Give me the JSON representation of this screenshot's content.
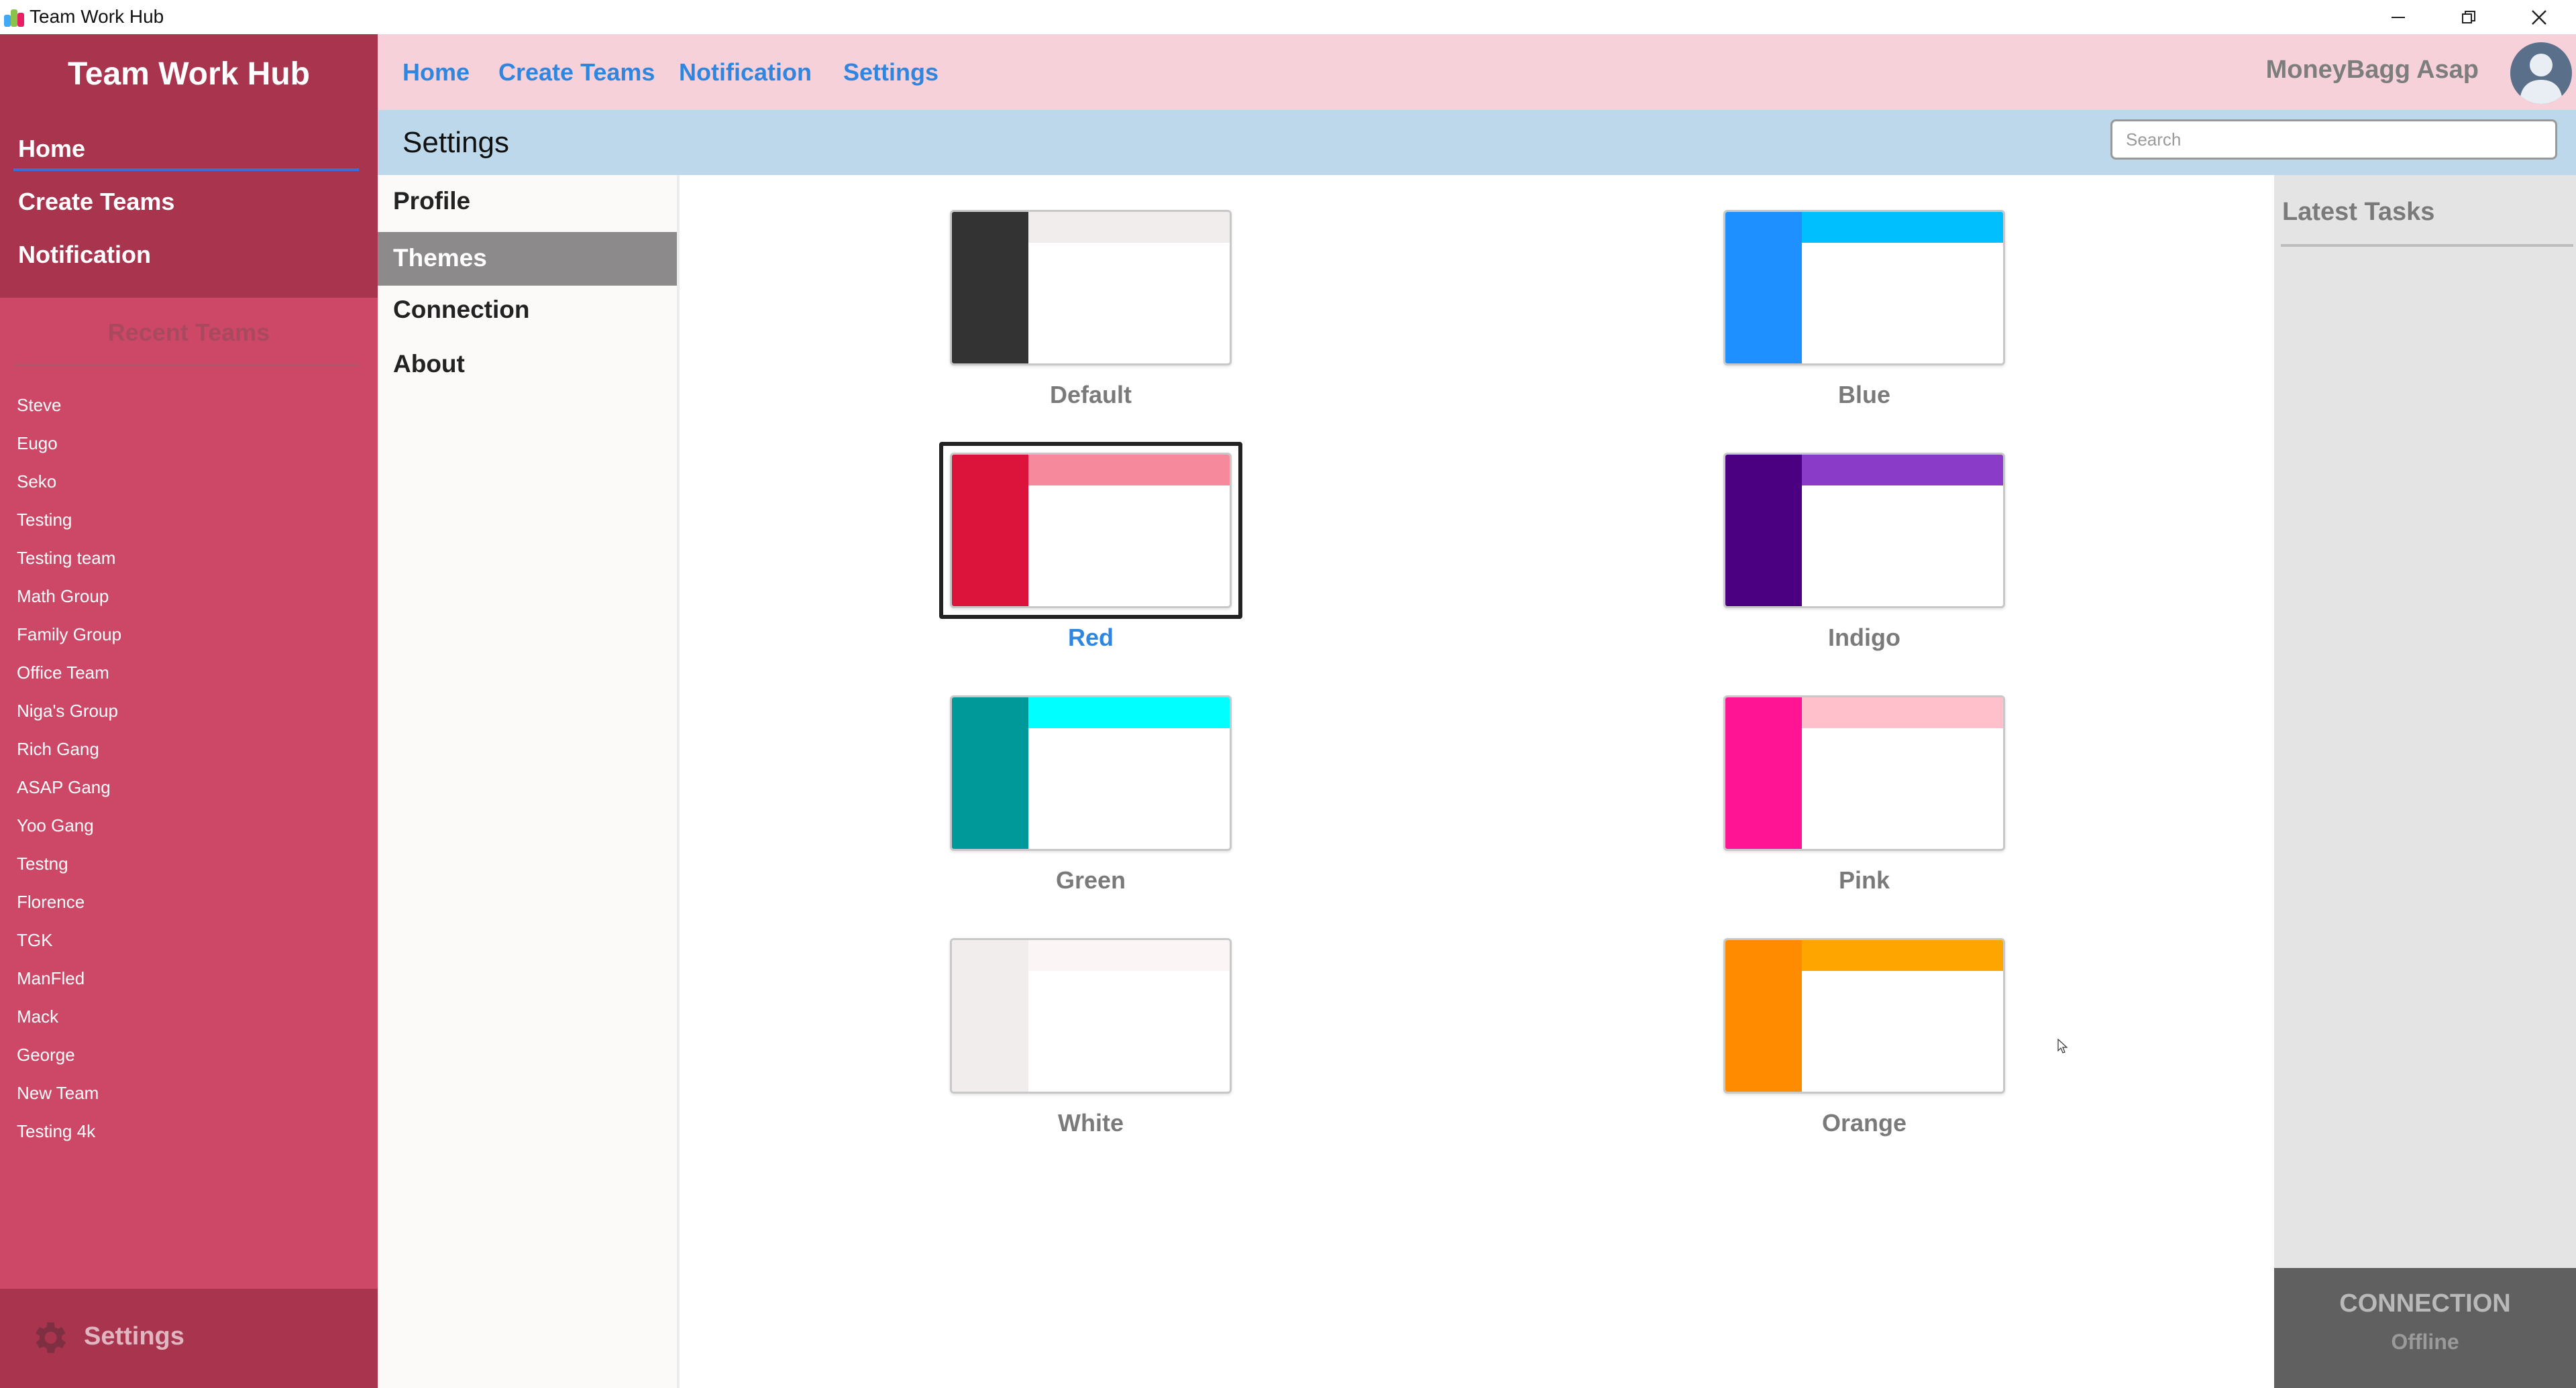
{
  "window": {
    "title": "Team Work Hub",
    "controls": [
      "minimize-icon",
      "restore-icon",
      "close-icon"
    ]
  },
  "sidebar": {
    "brand": "Team Work Hub",
    "nav": [
      {
        "label": "Home",
        "active": true
      },
      {
        "label": "Create Teams"
      },
      {
        "label": "Notification"
      }
    ],
    "recent_title": "Recent Teams",
    "recent_teams": [
      "Steve",
      "Eugo",
      "Seko",
      "Testing",
      "Testing team",
      "Math Group",
      "Family Group",
      "Office Team",
      "Niga's Group",
      "Rich Gang",
      "ASAP Gang",
      "Yoo Gang",
      "Testng",
      "Florence",
      "TGK",
      "ManFled",
      "Mack",
      "George",
      "New Team",
      "Testing 4k"
    ],
    "settings_label": "Settings",
    "settings_icon": "gear-icon"
  },
  "header": {
    "nav": [
      "Home",
      "Create Teams",
      "Notification",
      "Settings"
    ],
    "username": "MoneyBagg Asap",
    "avatar_icon": "user-avatar-icon"
  },
  "subheader": {
    "title": "Settings",
    "search_placeholder": "Search"
  },
  "settings_menu": {
    "items": [
      {
        "label": "Profile"
      },
      {
        "label": "Themes",
        "active": true
      },
      {
        "label": "Connection"
      },
      {
        "label": "About"
      }
    ]
  },
  "themes": {
    "selected": "Red",
    "items": [
      {
        "name": "Default",
        "side": "#333333",
        "head": "#f1edec"
      },
      {
        "name": "Blue",
        "side": "#1e90ff",
        "head": "#00bfff"
      },
      {
        "name": "Red",
        "side": "#dc143c",
        "head": "#f7899d"
      },
      {
        "name": "Indigo",
        "side": "#4b0082",
        "head": "#8a3cc8"
      },
      {
        "name": "Green",
        "side": "#009999",
        "head": "#00ffff"
      },
      {
        "name": "Pink",
        "side": "#ff1493",
        "head": "#ffc0cb"
      },
      {
        "name": "White",
        "side": "#f1edec",
        "head": "#fbf6f5"
      },
      {
        "name": "Orange",
        "side": "#ff8c00",
        "head": "#ffa500"
      }
    ]
  },
  "right_panel": {
    "title": "Latest Tasks",
    "connection_label": "CONNECTION",
    "connection_status": "Offline"
  },
  "colors": {
    "sidebar": "#cd4767",
    "sidebar_dark": "#a8344e",
    "header": "#f7d1da",
    "subheader": "#bcd8ea",
    "accent_link": "#2f86e0"
  }
}
